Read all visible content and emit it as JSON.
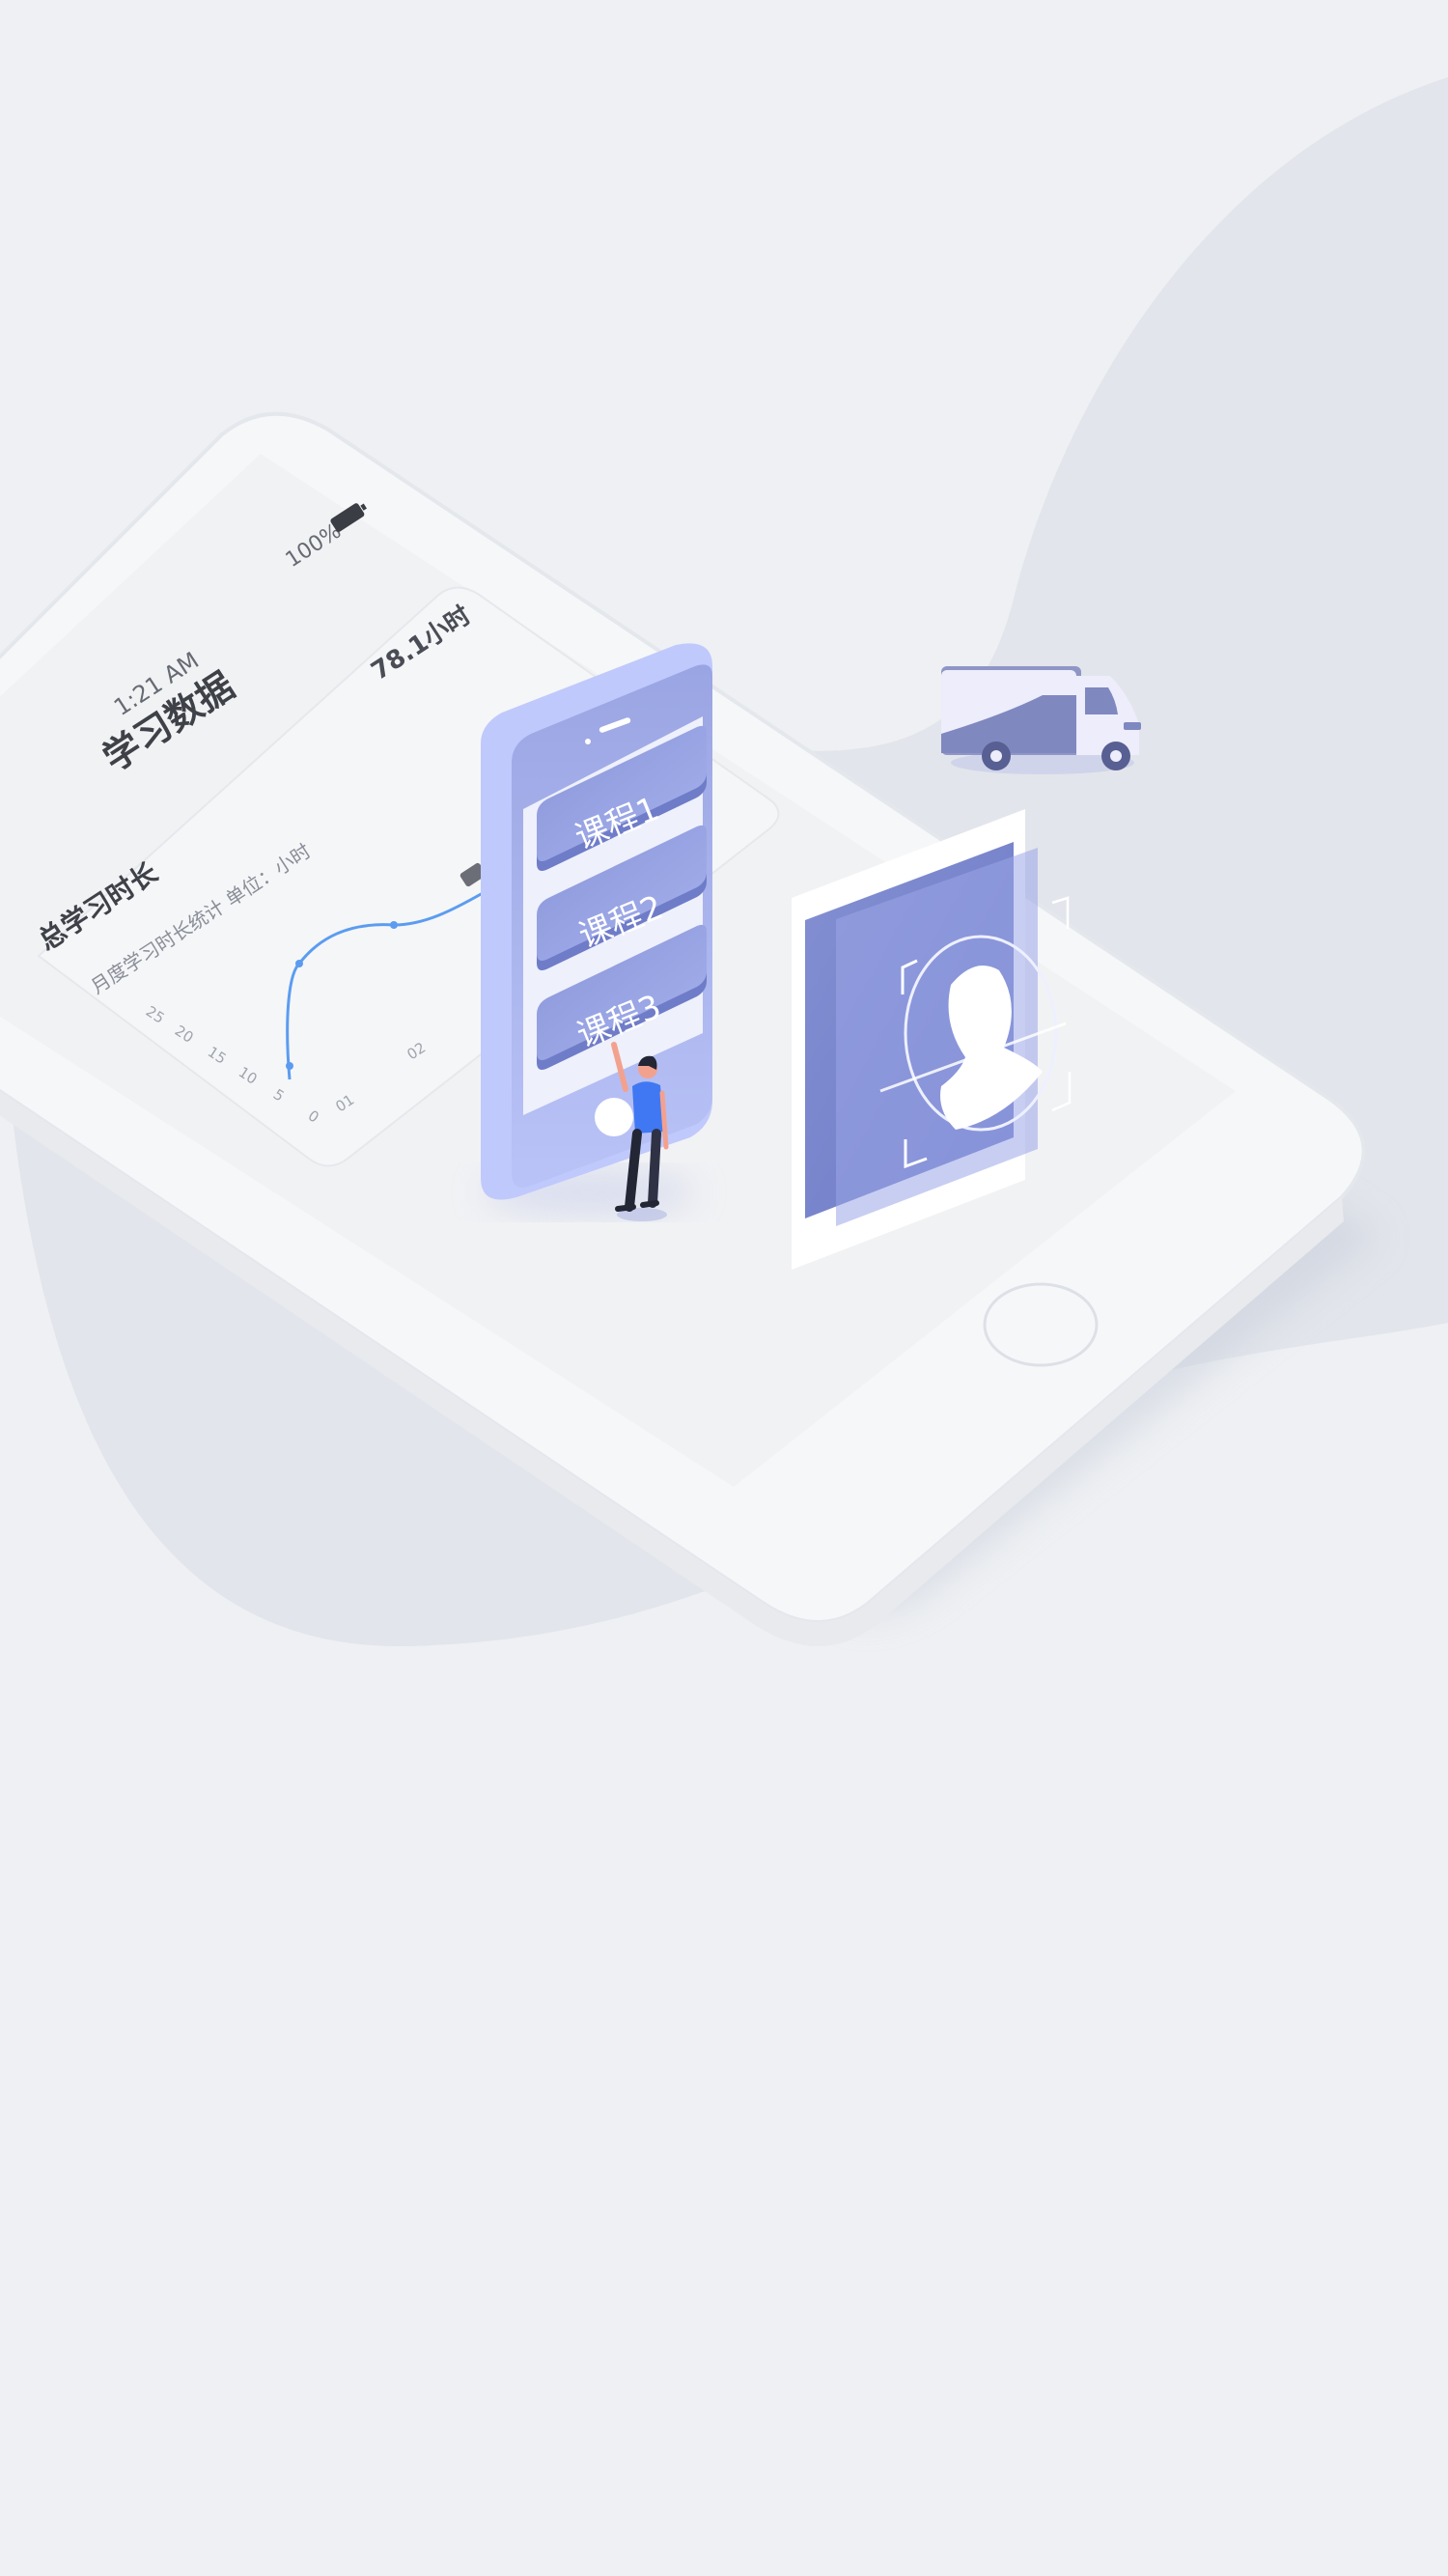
{
  "phone": {
    "status_bar": {
      "time": "1:21 AM",
      "battery_percent": "100%"
    },
    "page_title": "学习数据",
    "card": {
      "total_value": "78.1小时",
      "title": "总学习时长",
      "subtitle": "月度学习时长统计 单位：小时",
      "y_ticks": [
        "25",
        "20",
        "15",
        "10",
        "5",
        "0"
      ],
      "x_ticks": [
        "01",
        "02"
      ]
    }
  },
  "course_app": {
    "courses": [
      "课程1",
      "课程2",
      "课程3"
    ]
  },
  "colors": {
    "background": "#eef0f3",
    "blob": "#e2e5eb",
    "phone_body": "#f6f7f9",
    "accent": "#8f9bdb",
    "accent_dark": "#6f7cc8",
    "chart_line": "#5b9cf0",
    "person_shirt": "#3f78f2"
  },
  "icons": [
    "battery-icon",
    "truck-icon",
    "face-recognition-icon",
    "person-icon",
    "home-button-icon"
  ]
}
